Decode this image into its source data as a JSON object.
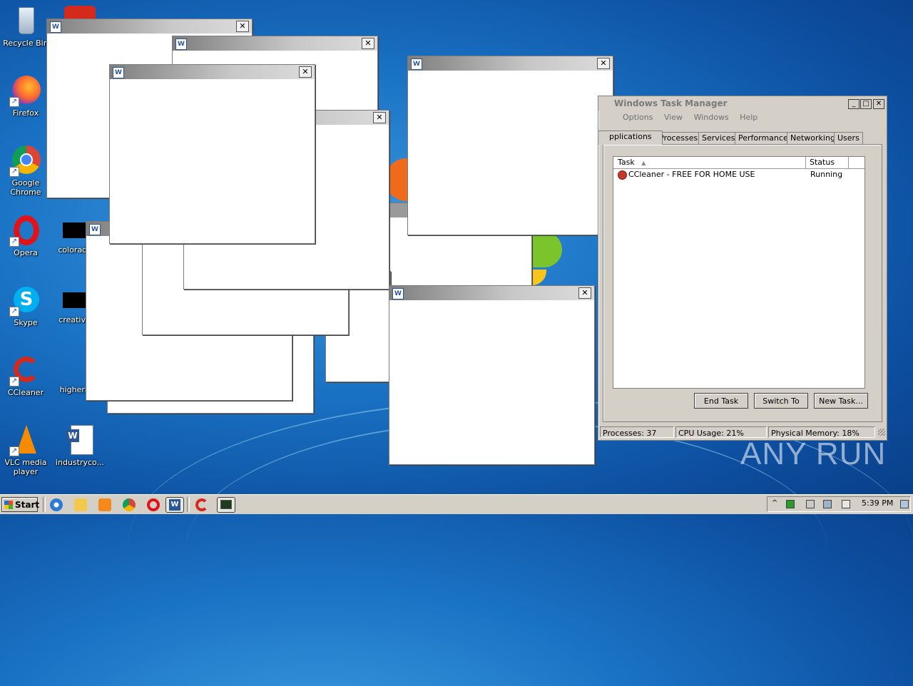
{
  "desktop": {
    "icons": [
      {
        "label": "Recycle Bin",
        "icon": "recycle-bin-icon"
      },
      {
        "label": "Firefox",
        "icon": "firefox-icon"
      },
      {
        "label": "Google Chrome",
        "icon": "chrome-icon"
      },
      {
        "label": "Opera",
        "icon": "opera-icon"
      },
      {
        "label": "Skype",
        "icon": "skype-icon"
      },
      {
        "label": "CCleaner",
        "icon": "ccleaner-icon"
      },
      {
        "label": "VLC media player",
        "icon": "vlc-icon"
      },
      {
        "label": "colorados",
        "icon": "file-icon"
      },
      {
        "label": "creativeg",
        "icon": "file-icon"
      },
      {
        "label": "higherho",
        "icon": "file-icon"
      },
      {
        "label": "industryco...",
        "icon": "word-document-icon"
      }
    ],
    "popup_close_glyph": "✕"
  },
  "task_manager": {
    "title": "Windows Task Manager",
    "menu": [
      "Options",
      "View",
      "Windows",
      "Help"
    ],
    "tabs": [
      "pplications",
      "Processes",
      "Services",
      "Performance",
      "Networking",
      "Users"
    ],
    "active_tab": "pplications",
    "columns": {
      "task": "Task",
      "status": "Status"
    },
    "rows": [
      {
        "task": "CCleaner - FREE FOR HOME USE",
        "status": "Running"
      }
    ],
    "buttons": {
      "end_task": "End Task",
      "switch_to": "Switch To",
      "new_task": "New Task..."
    },
    "status": {
      "processes": "Processes: 37",
      "cpu": "CPU Usage: 21%",
      "memory": "Physical Memory: 18%"
    }
  },
  "watermark": "ANY RUN",
  "taskbar": {
    "start_label": "Start",
    "clock": "5:39 PM"
  },
  "colors": {
    "desktop": "#1a72c4",
    "window_chrome": "#d4d0c8"
  }
}
